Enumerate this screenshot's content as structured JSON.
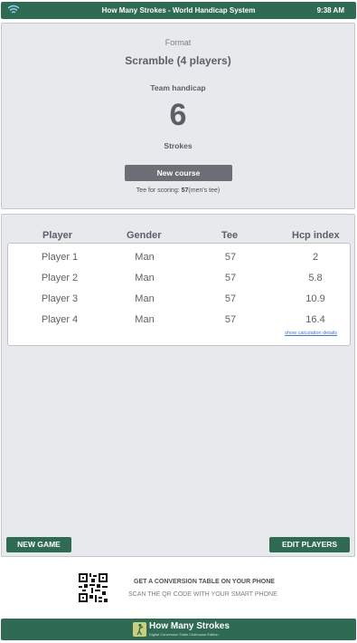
{
  "status_bar": {
    "title": "How Many Strokes - World Handicap System",
    "time": "9:38 AM",
    "wifi_icon": "wifi-icon"
  },
  "summary": {
    "format_label": "Format",
    "format_value": "Scramble (4 players)",
    "handicap_label": "Team handicap",
    "handicap_value": "6",
    "strokes_label": "Strokes",
    "new_course_label": "New course",
    "tee_prefix": "Tee for scoring: ",
    "tee_value": "57",
    "tee_suffix": "(men's tee)"
  },
  "players_table": {
    "headers": [
      "Player",
      "Gender",
      "Tee",
      "Hcp index"
    ],
    "rows": [
      [
        "Player 1",
        "Man",
        "57",
        "2"
      ],
      [
        "Player 2",
        "Man",
        "57",
        "5.8"
      ],
      [
        "Player 3",
        "Man",
        "57",
        "10.9"
      ],
      [
        "Player 4",
        "Man",
        "57",
        "16.4"
      ]
    ],
    "calc_link": "show calculation details"
  },
  "actions": {
    "new_game": "NEW GAME",
    "edit_players": "EDIT PLAYERS"
  },
  "promo": {
    "title": "GET A CONVERSION TABLE ON YOUR PHONE",
    "subtitle": "SCAN THE QR CODE WITH YOUR SMART PHONE",
    "qr_icon": "qr-code-icon"
  },
  "footer": {
    "brand": "How Many Strokes",
    "tagline": "Digital Conversion Table Clubhouse Edition",
    "logo_icon": "golfer-logo-icon"
  },
  "colors": {
    "brand_green": "#2f6a52",
    "panel_bg": "#e7e9ec",
    "button_gray": "#6b6e74",
    "link_blue": "#3a78c3"
  }
}
